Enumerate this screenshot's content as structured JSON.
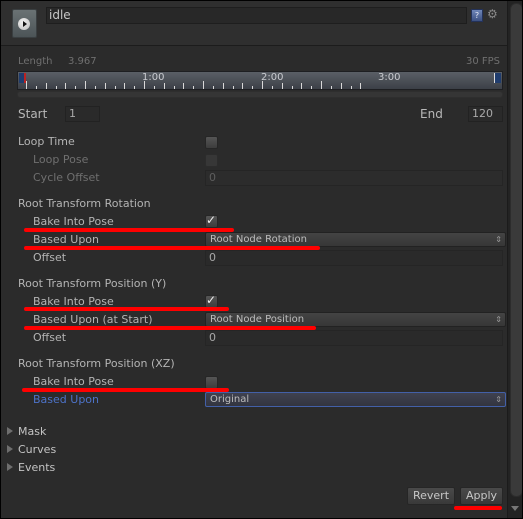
{
  "header": {
    "clip_name": "idle",
    "play_icon": "play-icon",
    "help_icon": "help-icon",
    "help_glyph": "?",
    "settings_icon": "gear-icon",
    "settings_glyph": "⚙"
  },
  "timeline": {
    "length_label": "Length",
    "length_value": "3.967",
    "fps_label": "30 FPS",
    "tick_labels": [
      "1:00",
      "2:00",
      "3:00"
    ]
  },
  "range": {
    "start_label": "Start",
    "start_value": "1",
    "end_label": "End",
    "end_value": "120"
  },
  "loop": {
    "loop_time_label": "Loop Time",
    "loop_time_checked": false,
    "loop_pose_label": "Loop Pose",
    "loop_pose_checked": false,
    "cycle_offset_label": "Cycle Offset",
    "cycle_offset_value": "0"
  },
  "root_rotation": {
    "title": "Root Transform Rotation",
    "bake_label": "Bake Into Pose",
    "bake_checked": true,
    "based_upon_label": "Based Upon",
    "based_upon_value": "Root Node Rotation",
    "offset_label": "Offset",
    "offset_value": "0"
  },
  "root_position_y": {
    "title": "Root Transform Position (Y)",
    "bake_label": "Bake Into Pose",
    "bake_checked": true,
    "based_upon_label": "Based Upon (at Start)",
    "based_upon_value": "Root Node Position",
    "offset_label": "Offset",
    "offset_value": "0"
  },
  "root_position_xz": {
    "title": "Root Transform Position (XZ)",
    "bake_label": "Bake Into Pose",
    "bake_checked": false,
    "based_upon_label": "Based Upon",
    "based_upon_value": "Original"
  },
  "foldouts": [
    "Mask",
    "Curves",
    "Events"
  ],
  "check_glyph": "✓",
  "dropdown_arrows": "⇕",
  "buttons": {
    "revert": "Revert",
    "apply": "Apply"
  },
  "colors": {
    "background": "#2b2b2b",
    "annotation_red": "#ff0000",
    "focus_blue": "#4d73c9"
  }
}
